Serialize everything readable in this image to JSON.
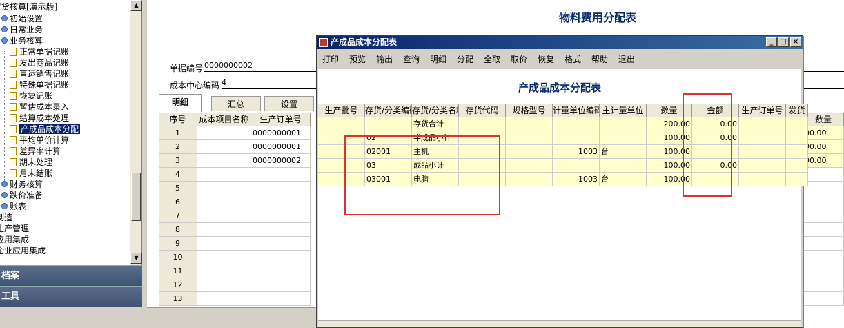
{
  "tree": {
    "root": "存货核算[演示版]",
    "items": [
      {
        "label": "初始设置",
        "kind": "node"
      },
      {
        "label": "日常业务",
        "kind": "node"
      },
      {
        "label": "业务核算",
        "kind": "node"
      },
      {
        "label": "正常单据记账",
        "kind": "folder"
      },
      {
        "label": "发出商品记账",
        "kind": "folder"
      },
      {
        "label": "直运销售记账",
        "kind": "folder"
      },
      {
        "label": "特殊单据记账",
        "kind": "folder"
      },
      {
        "label": "恢复记账",
        "kind": "folder"
      },
      {
        "label": "暂估成本录入",
        "kind": "folder"
      },
      {
        "label": "结算成本处理",
        "kind": "folder"
      },
      {
        "label": "产成品成本分配",
        "kind": "folder",
        "selected": true
      },
      {
        "label": "平均单价计算",
        "kind": "folder"
      },
      {
        "label": "差异率计算",
        "kind": "folder"
      },
      {
        "label": "期末处理",
        "kind": "folder"
      },
      {
        "label": "月末结账",
        "kind": "folder"
      },
      {
        "label": "财务核算",
        "kind": "node"
      },
      {
        "label": "跌价准备",
        "kind": "node"
      },
      {
        "label": "账表",
        "kind": "node"
      },
      {
        "label": "制造",
        "kind": "top"
      },
      {
        "label": "生产管理",
        "kind": "top"
      },
      {
        "label": "应用集成",
        "kind": "top"
      },
      {
        "label": "企业应用集成",
        "kind": "top"
      }
    ],
    "nav1": "档案",
    "nav2": "工具"
  },
  "bg": {
    "title": "物料费用分配表",
    "doc_no_label": "单据编号",
    "doc_no_value": "0000000002",
    "center_label": "成本中心编码",
    "center_value": "4",
    "tabs": [
      "明细",
      "汇总",
      "设置"
    ],
    "headers": [
      "序号",
      "成本项目名称",
      "生产订单号"
    ],
    "right_header": "数量",
    "rows": [
      {
        "no": "1",
        "order": "0000000001",
        "qty": "00.00"
      },
      {
        "no": "2",
        "order": "0000000001",
        "qty": "00.00"
      },
      {
        "no": "3",
        "order": "0000000002",
        "qty": "00.00"
      },
      {
        "no": "4"
      },
      {
        "no": "5"
      },
      {
        "no": "6"
      },
      {
        "no": "7"
      },
      {
        "no": "8"
      },
      {
        "no": "9"
      },
      {
        "no": "10"
      },
      {
        "no": "11"
      },
      {
        "no": "12"
      },
      {
        "no": "13"
      }
    ]
  },
  "dialog": {
    "title": "产成品成本分配表",
    "menu": [
      "打印",
      "预览",
      "输出",
      "查询",
      "明细",
      "分配",
      "全取",
      "取价",
      "恢复",
      "格式",
      "帮助",
      "退出"
    ],
    "table_title": "产成品成本分配表",
    "headers": [
      "生产批号",
      "存货/分类编码",
      "存货/分类名称",
      "存货代码",
      "规格型号",
      "计量单位编码",
      "主计量单位",
      "数量",
      "金额",
      "生产订单号",
      "发货"
    ],
    "rows": [
      {
        "code": "",
        "name": "存货合计",
        "unit_code": "",
        "unit": "",
        "qty": "200.00",
        "amt": "0.00"
      },
      {
        "code": "02",
        "name": "半成品小计",
        "unit_code": "",
        "unit": "",
        "qty": "100.00",
        "amt": "0.00"
      },
      {
        "code": "02001",
        "name": "主机",
        "unit_code": "1003",
        "unit": "台",
        "qty": "100.00",
        "amt": ""
      },
      {
        "code": "03",
        "name": "成品小计",
        "unit_code": "",
        "unit": "",
        "qty": "100.00",
        "amt": "0.00"
      },
      {
        "code": "03001",
        "name": "电脑",
        "unit_code": "1003",
        "unit": "台",
        "qty": "100.00",
        "amt": ""
      }
    ]
  }
}
